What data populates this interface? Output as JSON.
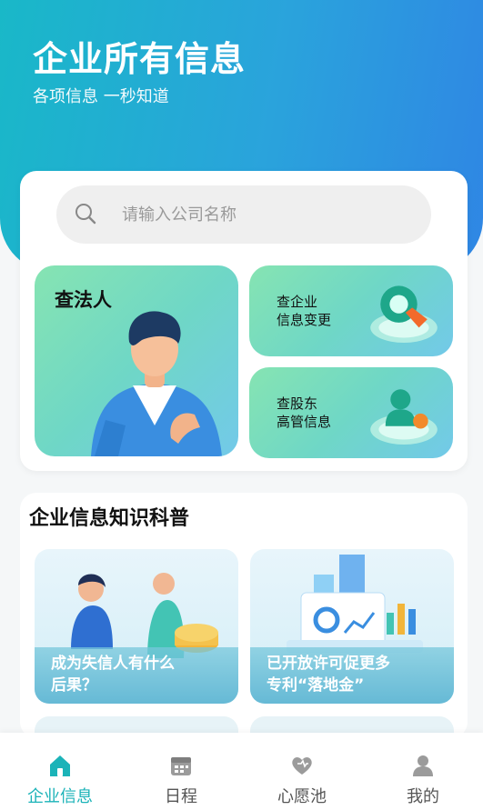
{
  "header": {
    "title": "企业所有信息",
    "subtitle": "各项信息 一秒知道"
  },
  "search": {
    "placeholder": "请输入公司名称",
    "value": ""
  },
  "quick_tiles": {
    "legal_person": "查法人",
    "change_line1": "查企业",
    "change_line2": "信息变更",
    "shareholder_line1": "查股东",
    "shareholder_line2": "高管信息"
  },
  "knowledge": {
    "title": "企业信息知识科普",
    "articles": [
      {
        "line1": "成为失信人有什么",
        "line2": "后果？"
      },
      {
        "line1": "已开放许可促更多",
        "line2": "专利“落地金”"
      }
    ]
  },
  "tabbar": {
    "items": [
      {
        "label": "企业信息",
        "icon": "building-icon"
      },
      {
        "label": "日程",
        "icon": "calendar-icon"
      },
      {
        "label": "心愿池",
        "icon": "heart-icon"
      },
      {
        "label": "我的",
        "icon": "user-icon"
      }
    ],
    "active_index": 0
  },
  "colors": {
    "accent": "#1bb3b8",
    "hero_start": "#19b8c8",
    "hero_end": "#2f86e4",
    "tile_green": "#86e4b2"
  }
}
